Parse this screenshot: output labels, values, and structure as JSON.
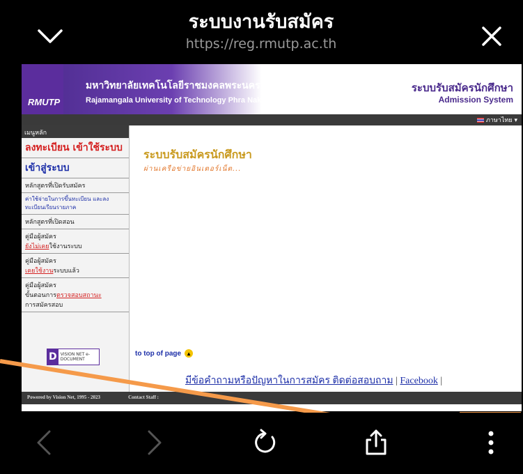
{
  "browser": {
    "title": "ระบบงานรับสมัคร",
    "url": "https://reg.rmutp.ac.th",
    "icons": {
      "collapse": "chevron-down-icon",
      "close": "close-icon"
    }
  },
  "banner": {
    "logo": "RMUTP",
    "university_th": "มหาวิทยาลัยเทคโนโลยีราชมงคลพระนคร",
    "university_en": "Rajamangala University of Technology Phra Nakhon",
    "system_th": "ระบบรับสมัครนักศึกษา",
    "system_en": "Admission System",
    "language": "ภาษาไทย ▾"
  },
  "sidebar": {
    "header": "เมนูหลัก",
    "items": [
      {
        "label": "ลงทะเบียน เข้าใช้ระบบ"
      },
      {
        "label": "เข้าสู่ระบบ"
      },
      {
        "label": "หลักสูตรที่เปิดรับสมัคร"
      },
      {
        "label": "ค่าใช้จ่ายในการขึ้นทะเบียน และลงทะเบียนเรียนรายภาค"
      },
      {
        "label": "หลักสูตรที่เปิดสอน"
      },
      {
        "label_a": "คู่มือผู้สมัคร",
        "label_b": "ยังไม่เคย",
        "label_c": "ใช้งานระบบ"
      },
      {
        "label_a": "คู่มือผู้สมัคร",
        "label_b": "เคยใช้งาน",
        "label_c": "ระบบแล้ว"
      },
      {
        "label_a": "คู่มือผู้สมัคร",
        "label_b": "ขั้นตอนการ",
        "label_c": "ตรวจสอบสถานะ",
        "label_d": "การสมัครสอบ"
      }
    ],
    "badge_letter": "D",
    "badge_text": "VISION NET e-DOCUMENT"
  },
  "content": {
    "title": "ระบบรับสมัครนักศึกษา",
    "subtitle": "ผ่านเครือข่ายอินเตอร์เน็ต...",
    "top_link": "to top of page",
    "contact_text": "มีข้อคำถามหรือปัญหาในการสมัคร ติดต่อสอบถาม",
    "contact_sep": " | ",
    "facebook": "Facebook",
    "contact_end": " |"
  },
  "footer": {
    "powered": "Powered by Vision Net, 1995 - 2023",
    "contact": "Contact Staff :"
  },
  "toolbar": {
    "icons": [
      "back-icon",
      "forward-icon",
      "reload-icon",
      "share-icon",
      "more-icon"
    ]
  },
  "annotation": {
    "color": "#f59a4a"
  }
}
